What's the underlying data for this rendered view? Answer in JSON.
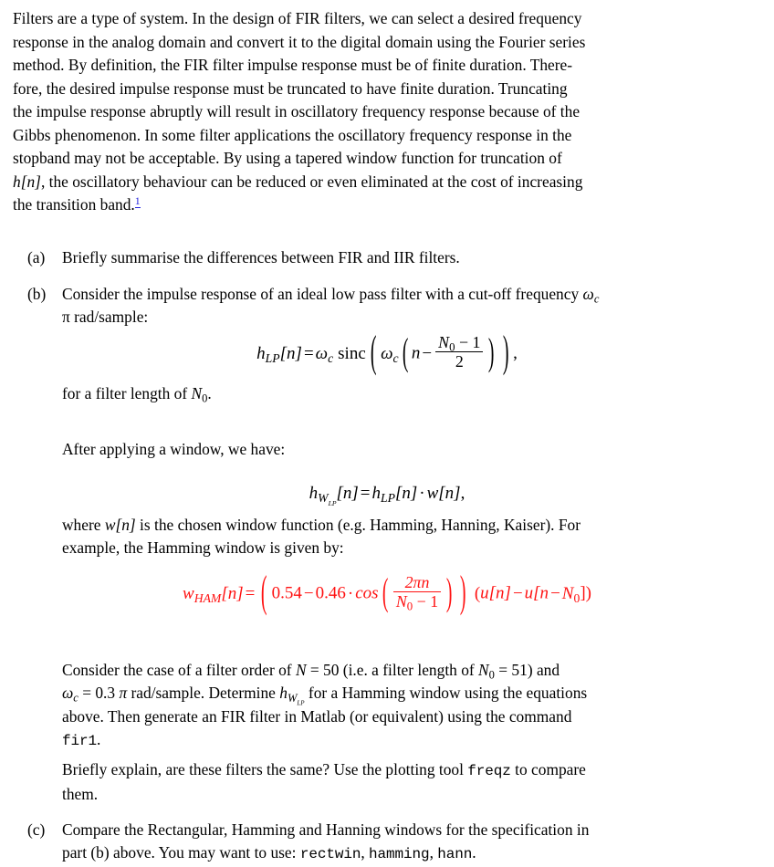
{
  "document": {
    "kind": "latex-exercise-sheet",
    "background_color": "#ffffff",
    "text_color": "#000000",
    "accent_colors": {
      "equation_highlight": "#ff1111",
      "hyperlink": "#2222dd"
    }
  },
  "intro": {
    "lines": [
      "Filters are a type of system. In the design of FIR filters, we can select a desired frequency",
      "response in the analog domain and convert it to the digital domain using the Fourier series",
      "method. By definition, the FIR filter impulse response must be of finite duration. There-",
      "fore, the desired impulse response must be truncated to have finite duration. Truncating",
      "the impulse response abruptly will result in oscillatory frequency response because of the",
      "Gibbs phenomenon. In some filter applications the oscillatory frequency response in the",
      "stopband may not be acceptable. By using a tapered window function for truncation of"
    ],
    "line8_pre": "h[n]",
    "line8_post": ", the oscillatory behaviour can be reduced or even eliminated at the cost of increasing",
    "line9": "the transition band.",
    "footnote_marker": "1"
  },
  "items": {
    "a": {
      "label": "(a)",
      "text": "Briefly summarise the differences between FIR and IIR filters."
    },
    "b": {
      "label": "(b)",
      "line1": "Consider the impulse response of an ideal low pass filter with a cut-off frequency",
      "line1_sym": "ω",
      "line1_sym_sub": "c",
      "line2": "π rad/sample:",
      "for_length_pre": "for a filter length of ",
      "for_length_sym": "N",
      "for_length_sub": "0",
      "for_length_post": ".",
      "after_window": "After applying a window, we have:",
      "where_line1_pre": "where ",
      "where_line1_sym": "w[n]",
      "where_line1_post": " is the chosen window function (e.g.  Hamming, Hanning, Kaiser).  For",
      "where_line2": "example, the Hamming window is given by:",
      "consider": {
        "l1_a": "Consider the case of a filter order of ",
        "l1_N": "N",
        "l1_b": " = 50 (i.e.  a filter length of ",
        "l1_N0": "N",
        "l1_N0sub": "0",
        "l1_c": " = 51) and",
        "l2_w": "ω",
        "l2_wsub": "c",
        "l2_a": " = 0.3 ",
        "l2_pi": "π",
        "l2_b": " rad/sample. Determine ",
        "l2_h": "h",
        "l2_hsub": "W",
        "l2_hsub2": "LP",
        "l2_c": " for a Hamming window using the equations",
        "l3": "above.  Then generate an FIR filter in Matlab (or equivalent) using the command",
        "l4_code": "fir1",
        "l4_end": "."
      },
      "briefly": {
        "l1_a": "Briefly explain, are these filters the same?  Use the plotting tool ",
        "l1_code": "freqz",
        "l1_b": " to compare",
        "l2": "them."
      }
    },
    "c": {
      "label": "(c)",
      "line1": "Compare the Rectangular, Hamming and Hanning windows for the specification in",
      "line2_pre": "part (b) above. You may want to use: ",
      "line2_code1": "rectwin",
      "line2_sep1": ", ",
      "line2_code2": "hamming",
      "line2_sep2": ", ",
      "line2_code3": "hann",
      "line2_end": "."
    }
  },
  "equations": {
    "hlp": {
      "id": "ideal-lowpass-impulse-response",
      "color": "#000000",
      "lhs_h": "h",
      "lhs_sub": "LP",
      "lhs_arg": "[n]",
      "eq": "=",
      "w": "ω",
      "w_sub": "c",
      "fn": "sinc",
      "inner_w": "ω",
      "inner_w_sub": "c",
      "n": "n",
      "minus": "−",
      "frac_num_N": "N",
      "frac_num_sub": "0",
      "frac_num_rest": " − 1",
      "frac_den": "2",
      "trailing": ","
    },
    "hwlp": {
      "id": "windowed-lowpass-impulse-response",
      "color": "#000000",
      "lhs_h": "h",
      "lhs_sub": "W",
      "lhs_sub2": "LP",
      "lhs_arg": "[n]",
      "eq": "=",
      "rhs_h": "h",
      "rhs_sub": "LP",
      "rhs_arg": "[n]",
      "dot": "·",
      "w": "w[n]",
      "trailing": ","
    },
    "hamming": {
      "id": "hamming-window-definition",
      "color": "#ff1111",
      "lhs_w": "w",
      "lhs_sub": "HAM",
      "lhs_arg": "[n]",
      "eq": "=",
      "a0": "0.54",
      "minus": "−",
      "a1": "0.46",
      "dot": "·",
      "cos": "cos",
      "frac_num": "2πn",
      "frac_den_N": "N",
      "frac_den_sub": "0",
      "frac_den_rest": " − 1",
      "step_open": "(",
      "step_u1": "u[n]",
      "step_minus": "−",
      "step_u2": "u[n",
      "step_minus2": "−",
      "step_N": "N",
      "step_Nsub": "0",
      "step_close": "])"
    }
  }
}
